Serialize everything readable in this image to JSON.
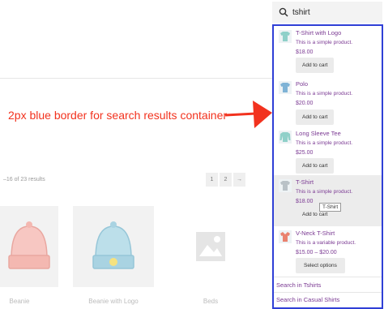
{
  "search": {
    "query": "tshirt",
    "icon": "search-icon"
  },
  "annotation": {
    "text": "2px blue border for search results container",
    "color": "#f2321e",
    "border_color": "#2f3fd6"
  },
  "background_page": {
    "result_count": "–16 of 23 results",
    "pagination": [
      "1",
      "2",
      "→"
    ],
    "products": [
      {
        "label": "Beanie"
      },
      {
        "label": "Beanie with Logo"
      },
      {
        "label": "Beds"
      }
    ]
  },
  "results": [
    {
      "title": "T-Shirt with Logo",
      "desc": "This is a simple product.",
      "price": "$18.00",
      "button": "Add to cart",
      "color": "#8fd0c9"
    },
    {
      "title": "Polo",
      "desc": "This is a simple product.",
      "price": "$20.00",
      "button": "Add to cart",
      "color": "#7fb3d6"
    },
    {
      "title": "Long Sleeve Tee",
      "desc": "This is a simple product.",
      "price": "$25.00",
      "button": "Add to cart",
      "color": "#8fd0c9"
    },
    {
      "title": "T-Shirt",
      "desc": "This is a simple product.",
      "price": "$18.00",
      "button": "Add to cart",
      "color": "#b9c2c7",
      "tooltip": "T-Shirt"
    },
    {
      "title": "V-Neck T-Shirt",
      "desc": "This is a variable product.",
      "price": "$15.00 – $20.00",
      "button": "Select options",
      "color": "#e9826e"
    }
  ],
  "footer_links": [
    "Search in Tshirts",
    "Search in Casual Shirts"
  ],
  "accent_color": "#7b3a93"
}
